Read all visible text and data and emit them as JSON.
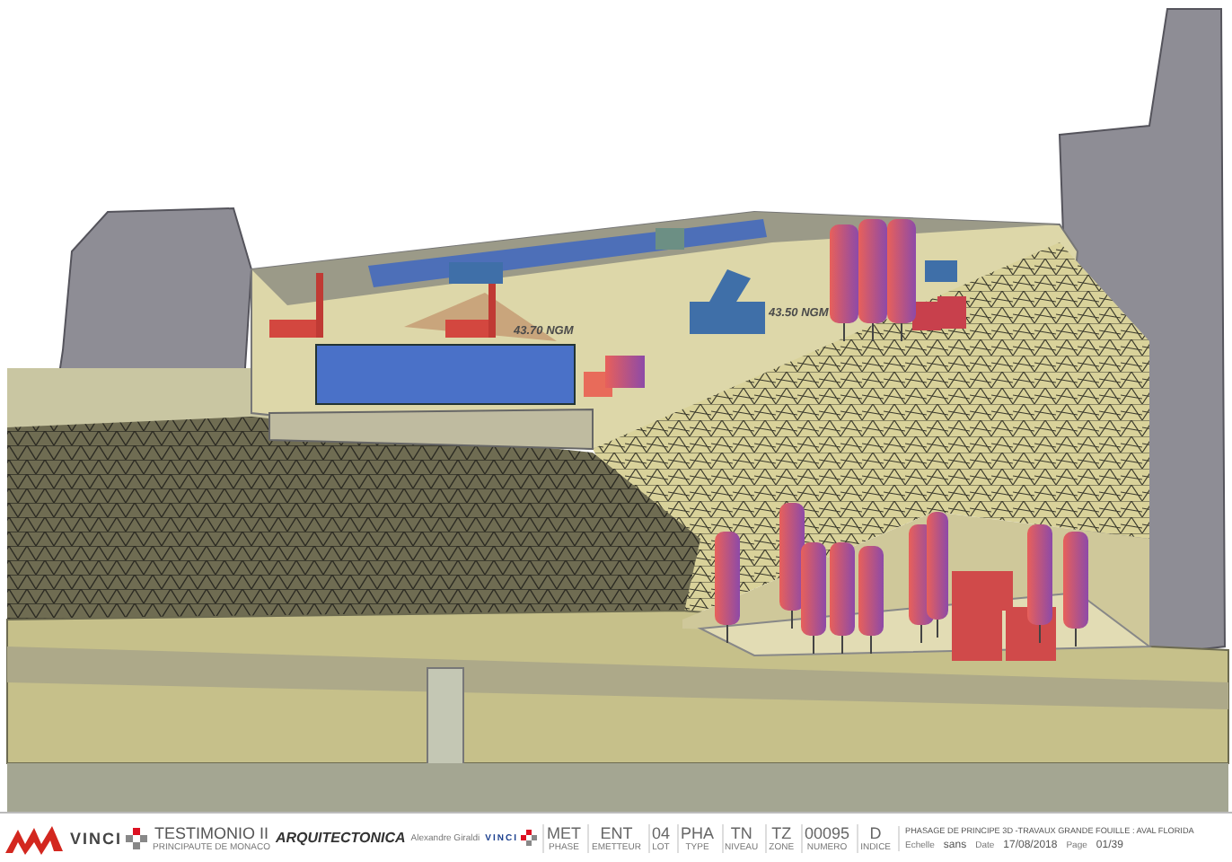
{
  "drawing": {
    "level_labels": [
      "43.70 NGM",
      "43.50 NGM"
    ]
  },
  "title_block": {
    "logos": [
      {
        "kind": "brand-mark"
      },
      {
        "kind": "wordmark",
        "text": "VINCI"
      },
      {
        "kind": "project",
        "text": "TESTIMONIO II",
        "subtitle": "PRINCIPAUTE DE MONACO"
      },
      {
        "kind": "firm",
        "text": "ARQUITECTONICA"
      },
      {
        "kind": "signature",
        "text": "Alexandre Giraldi"
      },
      {
        "kind": "wordmark-small",
        "text": "VINCI"
      }
    ],
    "codes": [
      {
        "value": "MET",
        "label": "PHASE"
      },
      {
        "value": "ENT",
        "label": "EMETTEUR"
      },
      {
        "value": "04",
        "label": "LOT"
      },
      {
        "value": "PHA",
        "label": "TYPE"
      },
      {
        "value": "TN",
        "label": "NIVEAU"
      },
      {
        "value": "TZ",
        "label": "ZONE"
      },
      {
        "value": "00095",
        "label": "NUMERO"
      },
      {
        "value": "D",
        "label": "INDICE"
      }
    ],
    "title": "PHASAGE DE PRINCIPE 3D -TRAVAUX GRANDE FOUILLE : AVAL FLORIDA",
    "meta": [
      {
        "label": "Echelle",
        "value": "sans"
      },
      {
        "label": "Date",
        "value": "17/08/2018"
      },
      {
        "label": "Page",
        "value": "01/39"
      }
    ]
  }
}
